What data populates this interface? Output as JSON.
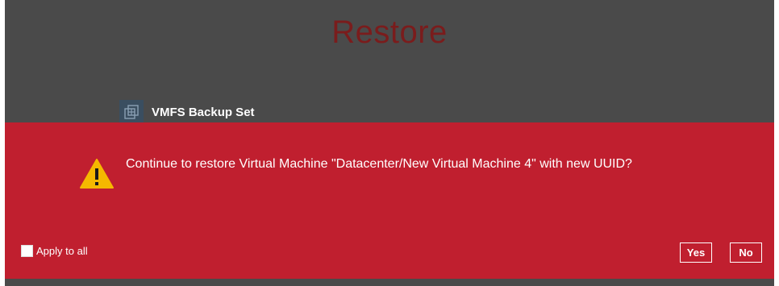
{
  "page": {
    "title": "Restore"
  },
  "backup_set": {
    "icon": "backup-set-icon",
    "name": "VMFS Backup Set"
  },
  "dialog": {
    "icon": "warning-icon",
    "message": "Continue to restore Virtual Machine \"Datacenter/New Virtual Machine 4\" with new UUID?",
    "apply_to_all": {
      "label": "Apply to all",
      "checked": false
    },
    "buttons": {
      "yes_label": "Yes",
      "no_label": "No"
    }
  },
  "colors": {
    "background": "#4a4a4a",
    "dialog": "#c01f2f",
    "title": "#7a1c1c",
    "warning": "#f5b800"
  }
}
